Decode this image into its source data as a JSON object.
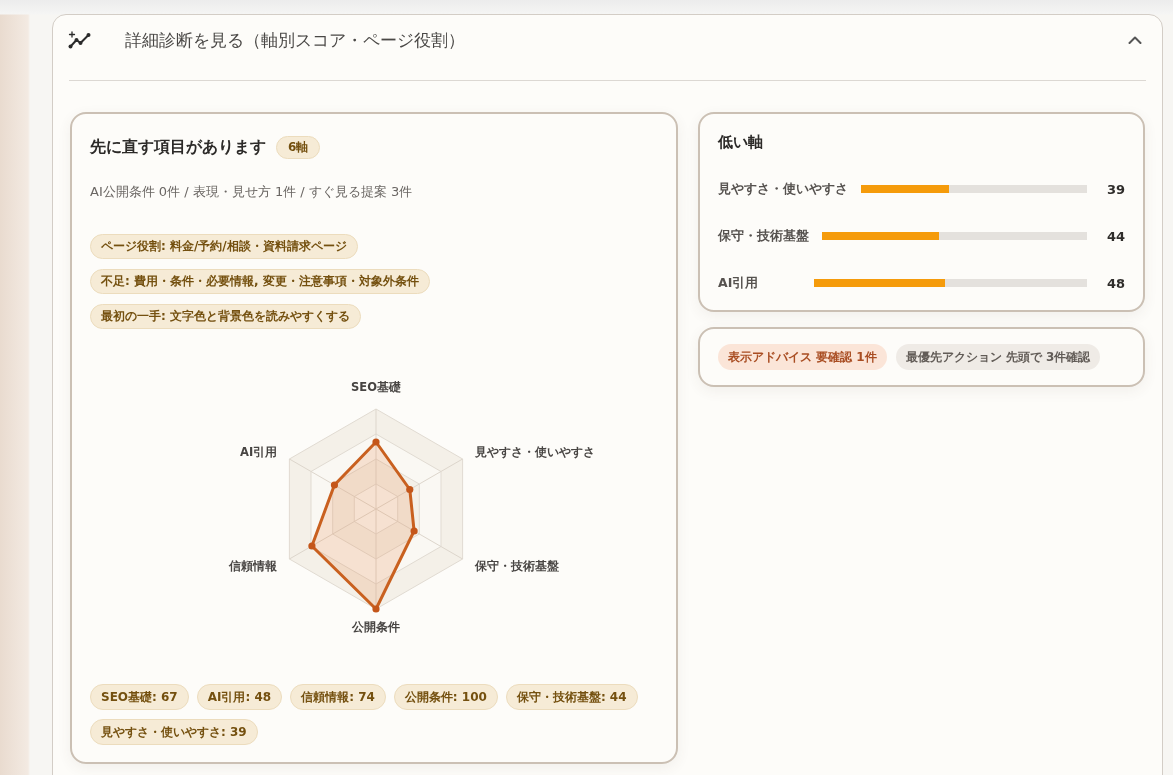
{
  "panel": {
    "title": "詳細診断を見る（軸別スコア・ページ役割）",
    "expanded": true
  },
  "summary": {
    "title": "先に直す項目があります",
    "badge": "6軸",
    "subtitle": "AI公開条件 0件 / 表現・見せ方 1件 / すぐ見る提案 3件",
    "tags": [
      "ページ役割: 料金/予約/相談・資料請求ページ",
      "不足: 費用・条件・必要情報, 変更・注意事項・対象外条件",
      "最初の一手: 文字色と背景色を読みやすくする"
    ],
    "radar": {
      "axes": [
        "SEO基礎",
        "見やすさ・使いやすさ",
        "保守・技術基盤",
        "公開条件",
        "信頼情報",
        "AI引用"
      ]
    },
    "scores": [
      "SEO基礎: 67",
      "AI引用: 48",
      "信頼情報: 74",
      "公開条件: 100",
      "保守・技術基盤: 44",
      "見やすさ・使いやすさ: 39"
    ]
  },
  "low_axes": {
    "title": "低い軸",
    "rows": [
      {
        "label": "見やすさ・使いやすさ",
        "level": 0.39,
        "value": "39"
      },
      {
        "label": "保守・技術基盤",
        "level": 0.44,
        "value": "44"
      },
      {
        "label": "AI引用",
        "level": 0.48,
        "value": "48"
      }
    ]
  },
  "notices": [
    {
      "text": "表示アドバイス 要確認 1件",
      "kind": "warning"
    },
    {
      "text": "最優先アクション 先頭で 3件確認",
      "kind": "neutral"
    }
  ]
}
